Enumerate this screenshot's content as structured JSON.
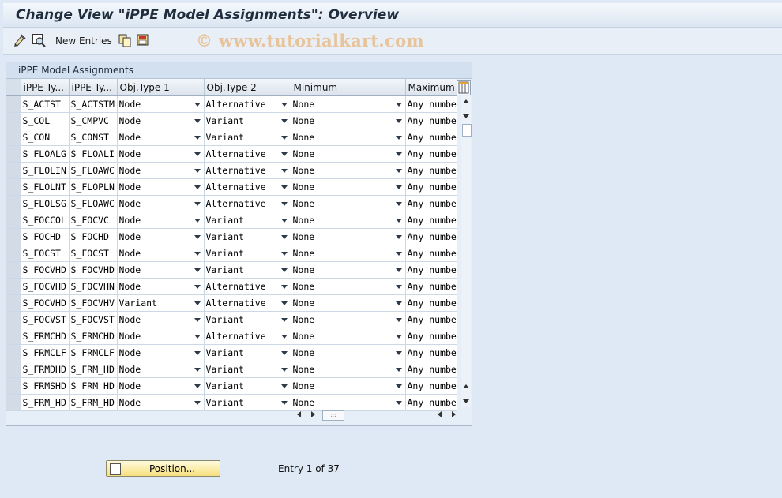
{
  "window": {
    "title": "Change View \"iPPE Model Assignments\": Overview"
  },
  "toolbar": {
    "new_entries_label": "New Entries",
    "icons": [
      "display-change-icon",
      "select-all-icon",
      "copy-icon",
      "save-delimit-icon"
    ]
  },
  "watermark": "© www.tutorialkart.com",
  "panel": {
    "title": "iPPE Model Assignments"
  },
  "table": {
    "columns": [
      "iPPE Ty...",
      "iPPE Ty...",
      "Obj.Type 1",
      "Obj.Type 2",
      "Minimum",
      "Maximum"
    ],
    "rows": [
      [
        "S_ACTST",
        "S_ACTSTM",
        "Node",
        "Alternative",
        "None",
        "Any numbe"
      ],
      [
        "S_COL",
        "S_CMPVC",
        "Node",
        "Variant",
        "None",
        "Any numbe"
      ],
      [
        "S_CON",
        "S_CONST",
        "Node",
        "Variant",
        "None",
        "Any numbe"
      ],
      [
        "S_FLOALG",
        "S_FLOALI",
        "Node",
        "Alternative",
        "None",
        "Any numbe"
      ],
      [
        "S_FLOLIN",
        "S_FLOAWC",
        "Node",
        "Alternative",
        "None",
        "Any numbe"
      ],
      [
        "S_FLOLNT",
        "S_FLOPLN",
        "Node",
        "Alternative",
        "None",
        "Any numbe"
      ],
      [
        "S_FLOLSG",
        "S_FLOAWC",
        "Node",
        "Alternative",
        "None",
        "Any numbe"
      ],
      [
        "S_FOCCOL",
        "S_FOCVC",
        "Node",
        "Variant",
        "None",
        "Any numbe"
      ],
      [
        "S_FOCHD",
        "S_FOCHD",
        "Node",
        "Variant",
        "None",
        "Any numbe"
      ],
      [
        "S_FOCST",
        "S_FOCST",
        "Node",
        "Variant",
        "None",
        "Any numbe"
      ],
      [
        "S_FOCVHD",
        "S_FOCVHD",
        "Node",
        "Variant",
        "None",
        "Any numbe"
      ],
      [
        "S_FOCVHD",
        "S_FOCVHN",
        "Node",
        "Alternative",
        "None",
        "Any numbe"
      ],
      [
        "S_FOCVHD",
        "S_FOCVHV",
        "Variant",
        "Alternative",
        "None",
        "Any numbe"
      ],
      [
        "S_FOCVST",
        "S_FOCVST",
        "Node",
        "Variant",
        "None",
        "Any numbe"
      ],
      [
        "S_FRMCHD",
        "S_FRMCHD",
        "Node",
        "Alternative",
        "None",
        "Any numbe"
      ],
      [
        "S_FRMCLF",
        "S_FRMCLF",
        "Node",
        "Variant",
        "None",
        "Any numbe"
      ],
      [
        "S_FRMDHD",
        "S_FRM_HD",
        "Node",
        "Variant",
        "None",
        "Any numbe"
      ],
      [
        "S_FRMSHD",
        "S_FRM_HD",
        "Node",
        "Variant",
        "None",
        "Any numbe"
      ],
      [
        "S_FRM_HD",
        "S_FRM_HD",
        "Node",
        "Variant",
        "None",
        "Any numbe"
      ]
    ]
  },
  "footer": {
    "position_label": "Position...",
    "entry_info": "Entry 1 of 37"
  },
  "colors": {
    "background": "#dfe9f5",
    "button_yellow": "#f7df7d",
    "watermark": "#e8c49c"
  }
}
